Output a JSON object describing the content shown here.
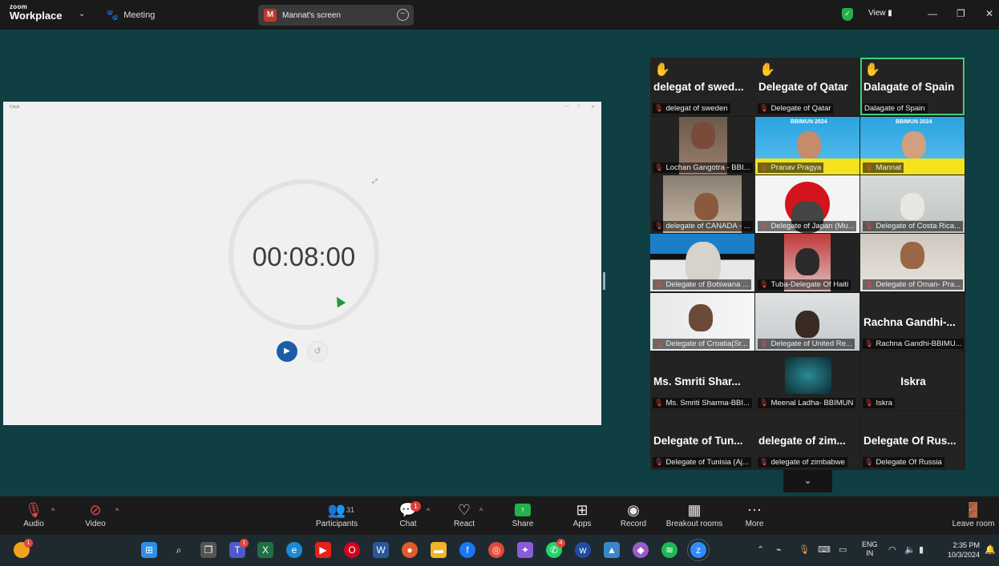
{
  "titlebar": {
    "brand_small": "zoom",
    "brand_big": "Workplace",
    "meeting_label": "Meeting",
    "share_badge_letter": "M",
    "share_label": "Mannat's screen",
    "view_label": "View"
  },
  "clock_app": {
    "window_title": "Clock",
    "time": "00:08:00"
  },
  "gallery": {
    "tiles": [
      {
        "big": "delegat of swed...",
        "label": "delegat of sweden",
        "hand": true
      },
      {
        "big": "Delegate of Qatar",
        "label": "Delegate of Qatar",
        "hand": true
      },
      {
        "big": "Dalagate of Spain",
        "label": "Dalagate of Spain",
        "hand": true,
        "active": true
      },
      {
        "label": "Lochan Gangotra - BBI..."
      },
      {
        "label": "Pranav Pragya",
        "banner": "BBIMUN 2024"
      },
      {
        "label": "Mannat",
        "banner": "BBIMUN 2024"
      },
      {
        "label": "delegate of CANADA - ..."
      },
      {
        "label": "Delegate of Japan (Mu..."
      },
      {
        "label": "Delegate of Costa Rica..."
      },
      {
        "label": "Delegate of Botswana ..."
      },
      {
        "label": "Tuba-Delegate Of Haiti"
      },
      {
        "label": "Delegate of Oman- Pra..."
      },
      {
        "label": "Delegate of Croatia(Sr..."
      },
      {
        "label": "Delegate of United Re..."
      },
      {
        "big": "Rachna Gandhi-...",
        "label": "Rachna Gandhi-BBIMU..."
      },
      {
        "big": "Ms. Smriti Shar...",
        "label": "Ms. Smriti Sharma-BBI..."
      },
      {
        "label": "Meenal Ladha- BBIMUN"
      },
      {
        "big": "Iskra",
        "label": "Iskra"
      },
      {
        "big": "Delegate of Tun...",
        "label": "Delegate of Tunisia (Aj..."
      },
      {
        "big": "delegate of zim...",
        "label": "delegate of zimbabwe"
      },
      {
        "big": "Delegate Of Rus...",
        "label": "Delegate Of Russia"
      }
    ]
  },
  "toolbar": {
    "audio": "Audio",
    "video": "Video",
    "participants": "Participants",
    "participants_count": "31",
    "chat": "Chat",
    "chat_badge": "1",
    "react": "React",
    "share": "Share",
    "apps": "Apps",
    "record": "Record",
    "breakout": "Breakout rooms",
    "more": "More",
    "leave": "Leave room"
  },
  "taskbar": {
    "lang_top": "ENG",
    "lang_bottom": "IN",
    "time": "2:35 PM",
    "date": "10/3/2024",
    "teams_badge": "1",
    "whatsapp_badge": "4",
    "start_badge": "1"
  },
  "colors": {
    "background": "#0f3f42",
    "active_border": "#3fd07a",
    "hand": "#f5b21b",
    "share_green": "#22b24c",
    "play_blue": "#1c5ca8"
  }
}
